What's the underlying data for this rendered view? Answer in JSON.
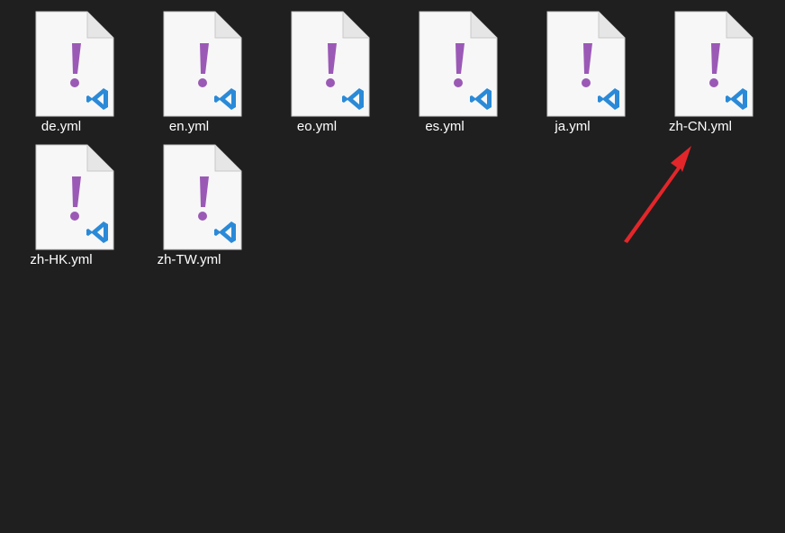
{
  "files": [
    {
      "name": "de.yml"
    },
    {
      "name": "en.yml"
    },
    {
      "name": "eo.yml"
    },
    {
      "name": "es.yml"
    },
    {
      "name": "ja.yml"
    },
    {
      "name": "zh-CN.yml"
    },
    {
      "name": "zh-HK.yml"
    },
    {
      "name": "zh-TW.yml"
    }
  ],
  "icons": {
    "file_icon": "yaml-vscode-file-icon",
    "exclaim_color": "#9b59b6",
    "vscode_color": "#2a8ad8"
  },
  "annotation": {
    "arrow_color": "#e3262a",
    "points_to": "zh-CN.yml"
  }
}
